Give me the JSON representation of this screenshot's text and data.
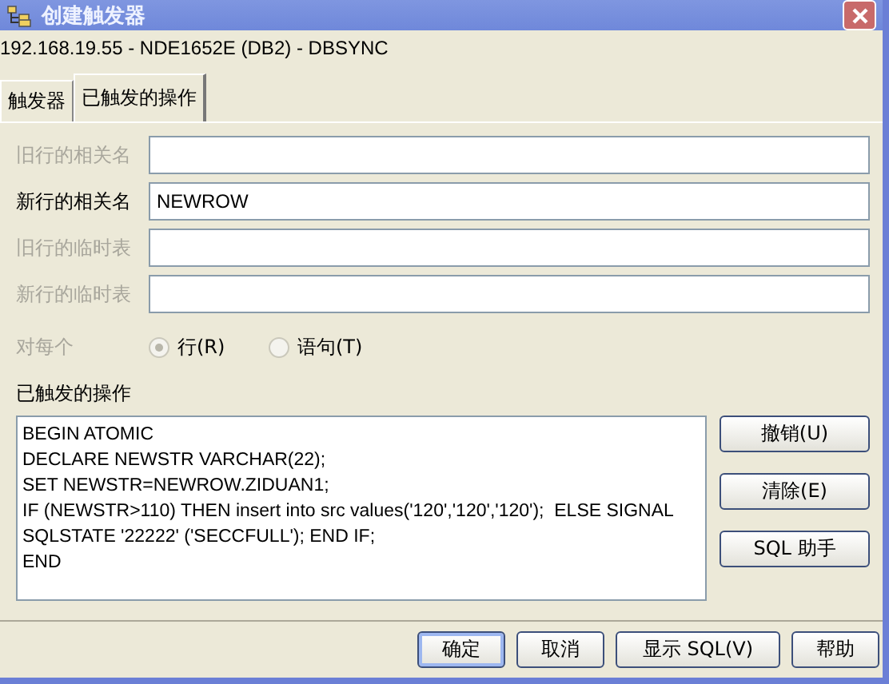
{
  "window": {
    "title": "创建触发器"
  },
  "connection": "192.168.19.55 - NDE1652E (DB2)  - DBSYNC",
  "tabs": [
    {
      "label": "触发器",
      "selected": false
    },
    {
      "label": "已触发的操作",
      "selected": true
    }
  ],
  "fields": [
    {
      "label": "旧行的相关名",
      "disabled": true
    },
    {
      "label": "新行的相关名",
      "value": "NEWROW",
      "disabled": false
    },
    {
      "label": "旧行的临时表",
      "disabled": true
    },
    {
      "label": "新行的临时表",
      "disabled": true
    }
  ],
  "for_each": {
    "label": "对每个",
    "disabled": true,
    "options": [
      {
        "label": "行(R)",
        "selected": true
      },
      {
        "label": "语句(T)",
        "selected": false
      }
    ]
  },
  "action": {
    "label": "已触发的操作",
    "sql": "BEGIN ATOMIC\nDECLARE NEWSTR VARCHAR(22);\nSET NEWSTR=NEWROW.ZIDUAN1;\nIF (NEWSTR>110) THEN insert into src values('120','120','120');  ELSE SIGNAL\nSQLSTATE '22222' ('SECCFULL'); END IF;\nEND"
  },
  "side_buttons": [
    "撤销(U)",
    "清除(E)",
    "SQL 助手"
  ],
  "buttons": [
    {
      "label": "确定",
      "default": true
    },
    {
      "label": "取消",
      "default": false
    },
    {
      "label": "显示 SQL(V)",
      "default": false
    },
    {
      "label": "帮助",
      "default": false
    }
  ]
}
